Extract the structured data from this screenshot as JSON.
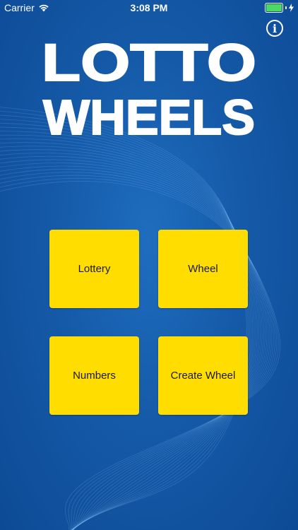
{
  "status_bar": {
    "carrier": "Carrier",
    "time": "3:08 PM",
    "battery_color": "#4cd964"
  },
  "info_button": {
    "glyph": "i"
  },
  "logo": {
    "line1": "LOTTO",
    "line2": "WHEELS"
  },
  "menu": {
    "lottery_label": "Lottery",
    "wheel_label": "Wheel",
    "numbers_label": "Numbers",
    "create_wheel_label": "Create Wheel"
  },
  "colors": {
    "background": "#155aa8",
    "tile": "#ffdd00",
    "tile_text": "#1a1a1a"
  },
  "icons": {
    "wifi": "wifi-icon",
    "battery": "battery-icon",
    "charging": "charging-bolt-icon",
    "info": "info-icon"
  }
}
